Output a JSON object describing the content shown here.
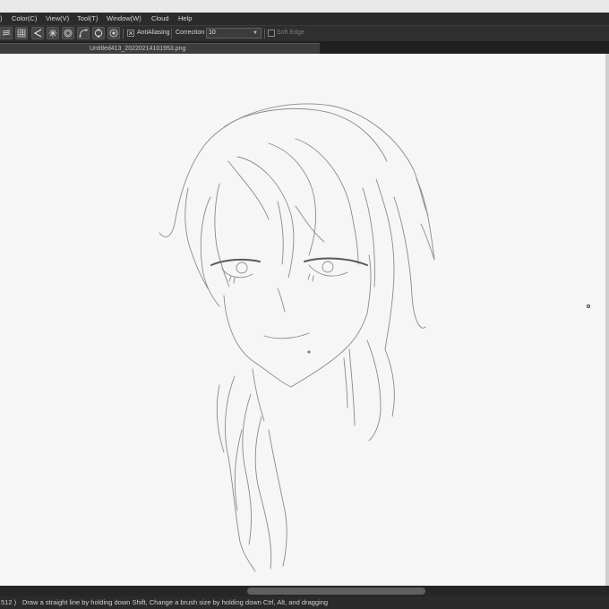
{
  "menubar": {
    "items": [
      {
        "label": ")"
      },
      {
        "label": "Color(C)"
      },
      {
        "label": "View(V)"
      },
      {
        "label": "Tool(T)"
      },
      {
        "label": "Window(W)"
      },
      {
        "label": "Cloud"
      },
      {
        "label": "Help"
      }
    ]
  },
  "toolbar": {
    "buttons": [
      {
        "icon": "layer-list-icon"
      },
      {
        "icon": "grid-icon"
      },
      {
        "icon": "perspective-ruler-icon"
      },
      {
        "icon": "radial-lines-icon"
      },
      {
        "icon": "concentric-circles-icon"
      },
      {
        "icon": "curve-ruler-icon"
      },
      {
        "icon": "circle-ruler-icon"
      },
      {
        "icon": "symmetry-ruler-icon"
      }
    ],
    "antialiasing": {
      "label": "AntiAliasing",
      "checked": true
    },
    "correction": {
      "label": "Correction",
      "value": "10"
    },
    "soft_edge": {
      "label": "Soft Edge",
      "checked": false
    }
  },
  "document": {
    "tab_title": "Untitled413_20220214101953.png"
  },
  "statusbar": {
    "coords": "512 )",
    "hint": "Draw a straight line by holding down Shift, Change a brush size by holding down Ctrl, Alt, and dragging"
  },
  "colors": {
    "menubar_bg": "#2b2b2b",
    "toolbar_bg": "#2f2f2f",
    "canvas_bg": "#f6f6f6",
    "sketch_stroke": "#8a8a8a"
  }
}
